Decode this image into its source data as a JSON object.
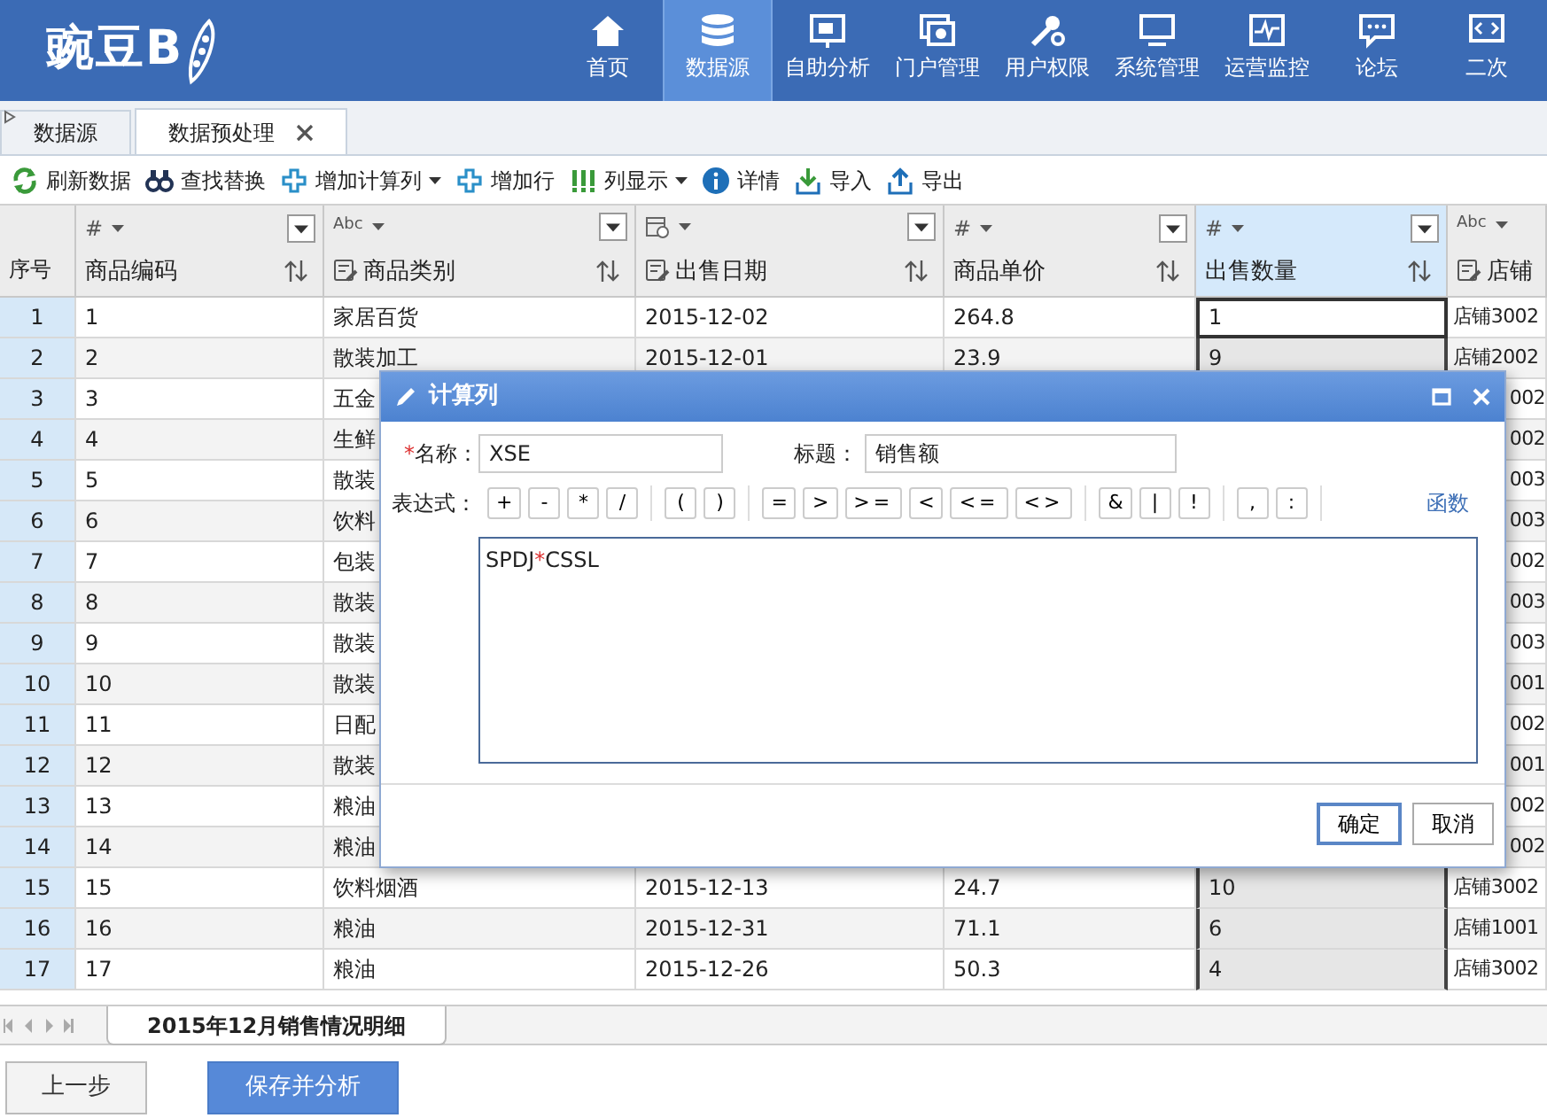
{
  "app": {
    "logo": "豌豆B"
  },
  "nav": [
    {
      "label": "首页",
      "selected": false
    },
    {
      "label": "数据源",
      "selected": true
    },
    {
      "label": "自助分析",
      "selected": false
    },
    {
      "label": "门户管理",
      "selected": false
    },
    {
      "label": "用户权限",
      "selected": false
    },
    {
      "label": "系统管理",
      "selected": false
    },
    {
      "label": "运营监控",
      "selected": false
    },
    {
      "label": "论坛",
      "selected": false
    },
    {
      "label": "二次",
      "selected": false
    }
  ],
  "tabs": [
    {
      "label": "数据源",
      "selected": false,
      "closable": false
    },
    {
      "label": "数据预处理",
      "selected": true,
      "closable": true
    }
  ],
  "toolbar": [
    {
      "label": "刷新数据",
      "dropdown": false
    },
    {
      "label": "查找替换",
      "dropdown": false
    },
    {
      "label": "增加计算列",
      "dropdown": true
    },
    {
      "label": "增加行",
      "dropdown": false
    },
    {
      "label": "列显示",
      "dropdown": true
    },
    {
      "label": "详情",
      "dropdown": false
    },
    {
      "label": "导入",
      "dropdown": false
    },
    {
      "label": "导出",
      "dropdown": false
    }
  ],
  "grid": {
    "row_header": "序号",
    "columns": [
      {
        "type_label": "#",
        "name": "商品编码",
        "dimension": false,
        "selected": false
      },
      {
        "type_label": "Abc",
        "name": "商品类别",
        "dimension": true,
        "selected": false
      },
      {
        "name": "出售日期",
        "dimension": true,
        "selected": false
      },
      {
        "type_label": "#",
        "name": "商品单价",
        "dimension": false,
        "selected": false
      },
      {
        "type_label": "#",
        "name": "出售数量",
        "dimension": false,
        "selected": true
      },
      {
        "type_label": "Abc",
        "name": "店铺",
        "dimension": true,
        "selected": false
      }
    ],
    "rows": [
      {
        "index": "1",
        "selected": true,
        "covered": false,
        "cells": [
          "1",
          "家居百货",
          "2015-12-02",
          "264.8",
          "1",
          "店铺3002"
        ]
      },
      {
        "index": "2",
        "selected": false,
        "covered": false,
        "cells": [
          "2",
          "散装加工",
          "2015-12-01",
          "23.9",
          "9",
          "店铺2002"
        ]
      },
      {
        "index": "3",
        "selected": false,
        "covered": true,
        "cells": [
          "3",
          "五金",
          null,
          null,
          null,
          "002"
        ]
      },
      {
        "index": "4",
        "selected": false,
        "covered": true,
        "cells": [
          "4",
          "生鲜",
          null,
          null,
          null,
          "002"
        ]
      },
      {
        "index": "5",
        "selected": false,
        "covered": true,
        "cells": [
          "5",
          "散装",
          null,
          null,
          null,
          "003"
        ]
      },
      {
        "index": "6",
        "selected": false,
        "covered": true,
        "cells": [
          "6",
          "饮料",
          null,
          null,
          null,
          "003"
        ]
      },
      {
        "index": "7",
        "selected": false,
        "covered": true,
        "cells": [
          "7",
          "包装",
          null,
          null,
          null,
          "002"
        ]
      },
      {
        "index": "8",
        "selected": false,
        "covered": true,
        "cells": [
          "8",
          "散装",
          null,
          null,
          null,
          "003"
        ]
      },
      {
        "index": "9",
        "selected": false,
        "covered": true,
        "cells": [
          "9",
          "散装",
          null,
          null,
          null,
          "003"
        ]
      },
      {
        "index": "10",
        "selected": false,
        "covered": true,
        "cells": [
          "10",
          "散装",
          null,
          null,
          null,
          "001"
        ]
      },
      {
        "index": "11",
        "selected": false,
        "covered": true,
        "cells": [
          "11",
          "日配",
          null,
          null,
          null,
          "002"
        ]
      },
      {
        "index": "12",
        "selected": false,
        "covered": true,
        "cells": [
          "12",
          "散装",
          null,
          null,
          null,
          "001"
        ]
      },
      {
        "index": "13",
        "selected": false,
        "covered": true,
        "cells": [
          "13",
          "粮油",
          null,
          null,
          null,
          "002"
        ]
      },
      {
        "index": "14",
        "selected": false,
        "covered": true,
        "cells": [
          "14",
          "粮油",
          null,
          null,
          null,
          "002"
        ]
      },
      {
        "index": "15",
        "selected": false,
        "covered": false,
        "cells": [
          "15",
          "饮料烟酒",
          "2015-12-13",
          "24.7",
          "10",
          "店铺3002"
        ]
      },
      {
        "index": "16",
        "selected": false,
        "covered": false,
        "cells": [
          "16",
          "粮油",
          "2015-12-31",
          "71.1",
          "6",
          "店铺1001"
        ]
      },
      {
        "index": "17",
        "selected": false,
        "covered": false,
        "cells": [
          "17",
          "粮油",
          "2015-12-26",
          "50.3",
          "4",
          "店铺3002"
        ]
      }
    ]
  },
  "dialog": {
    "title": "计算列",
    "required_mark": "*",
    "name_label": "名称：",
    "name_value": "XSE",
    "caption_label": "标题：",
    "caption_value": "销售额",
    "expression_label": "表达式：",
    "operator_groups": [
      [
        "+",
        "-",
        "*",
        "/"
      ],
      [
        "(",
        ")"
      ],
      [
        "=",
        ">",
        ">=",
        "<",
        "<=",
        "<>"
      ],
      [
        "&",
        "|",
        "!"
      ],
      [
        ",",
        ":"
      ]
    ],
    "functions_link": "函数",
    "expression": [
      {
        "text": "SPDJ",
        "kind": "field"
      },
      {
        "text": "*",
        "kind": "operator"
      },
      {
        "text": "CSSL",
        "kind": "field"
      }
    ],
    "buttons": [
      {
        "label": "确定",
        "primary": true
      },
      {
        "label": "取消",
        "primary": false
      }
    ]
  },
  "sheets": [
    {
      "label": "2015年12月销售情况明细",
      "selected": true
    }
  ],
  "footer_buttons": [
    {
      "label": "上一步",
      "kind": "secondary"
    },
    {
      "label": "保存并分析",
      "kind": "primary"
    }
  ]
}
